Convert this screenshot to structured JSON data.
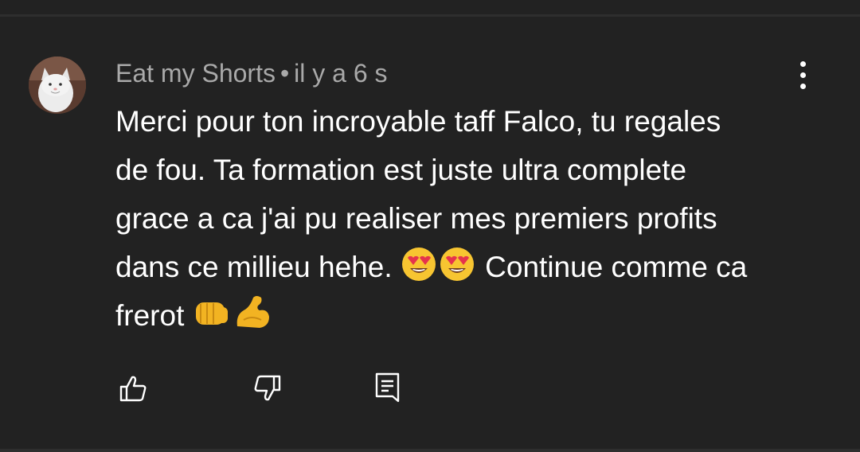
{
  "comment": {
    "author": "Eat my Shorts",
    "separator": "•",
    "timestamp": "il y a 6 s",
    "lines": [
      "Merci pour ton incroyable taff Falco, tu regales",
      "de fou. Ta formation est juste ultra complete",
      "grace a ca j'ai pu realiser mes premiers profits",
      "dans ce millieu hehe.",
      "Continue comme ca",
      "frerot"
    ],
    "emojis": [
      "smiling-face-with-heart-eyes",
      "smiling-face-with-heart-eyes",
      "oncoming-fist",
      "flexed-biceps"
    ]
  },
  "icons": {
    "more": "vertical-ellipsis-icon",
    "like": "thumb-up-icon",
    "dislike": "thumb-down-icon",
    "reply": "reply-comment-icon"
  },
  "colors": {
    "background": "#222222",
    "meta_text": "#a9a9a9",
    "body_text": "#ffffff",
    "divider": "#2e2e2e"
  }
}
